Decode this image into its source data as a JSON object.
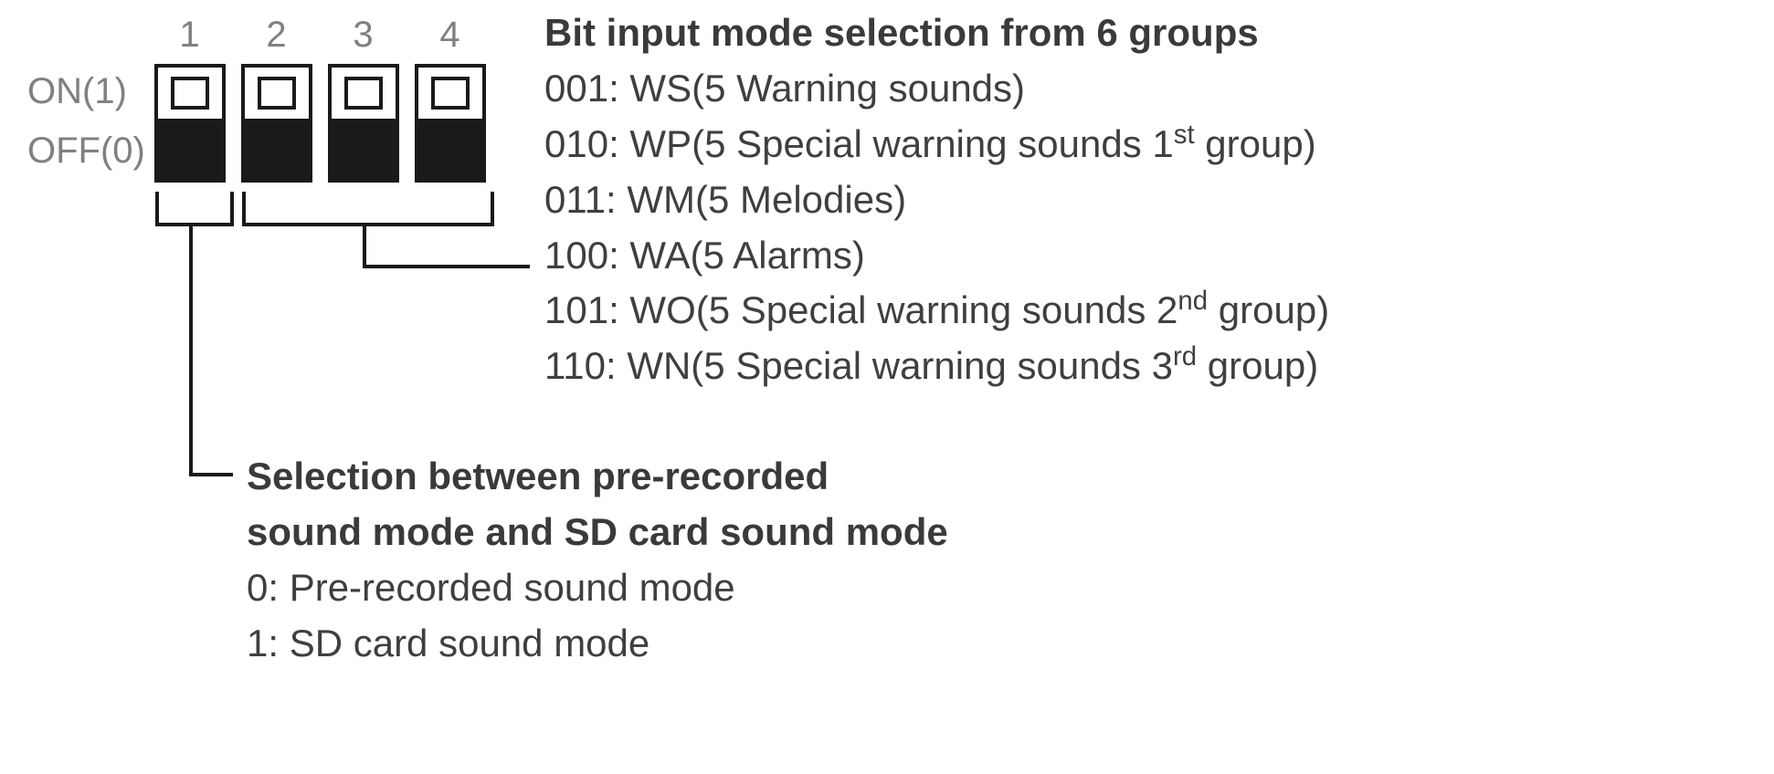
{
  "dip": {
    "columns": [
      "1",
      "2",
      "3",
      "4"
    ],
    "on_label": "ON(1)",
    "off_label": "OFF(0)"
  },
  "right": {
    "heading": "Bit input mode selection from 6 groups",
    "items": [
      {
        "code": "001",
        "abbr": "WS",
        "desc_pre": "5 Warning sounds",
        "ord": "",
        "desc_post": ""
      },
      {
        "code": "010",
        "abbr": "WP",
        "desc_pre": "5 Special warning sounds 1",
        "ord": "st",
        "desc_post": " group"
      },
      {
        "code": "011",
        "abbr": "WM",
        "desc_pre": "5 Melodies",
        "ord": "",
        "desc_post": ""
      },
      {
        "code": "100",
        "abbr": "WA",
        "desc_pre": "5 Alarms",
        "ord": "",
        "desc_post": ""
      },
      {
        "code": "101",
        "abbr": "WO",
        "desc_pre": "5 Special warning sounds 2",
        "ord": "nd",
        "desc_post": " group"
      },
      {
        "code": "110",
        "abbr": "WN",
        "desc_pre": "5 Special warning sounds 3",
        "ord": "rd",
        "desc_post": " group"
      }
    ]
  },
  "lower": {
    "heading_line1": "Selection between pre-recorded",
    "heading_line2": "sound mode and SD card sound mode",
    "items": [
      {
        "code": "0",
        "desc": "Pre-recorded sound mode"
      },
      {
        "code": "1",
        "desc": "SD card sound mode"
      }
    ]
  }
}
